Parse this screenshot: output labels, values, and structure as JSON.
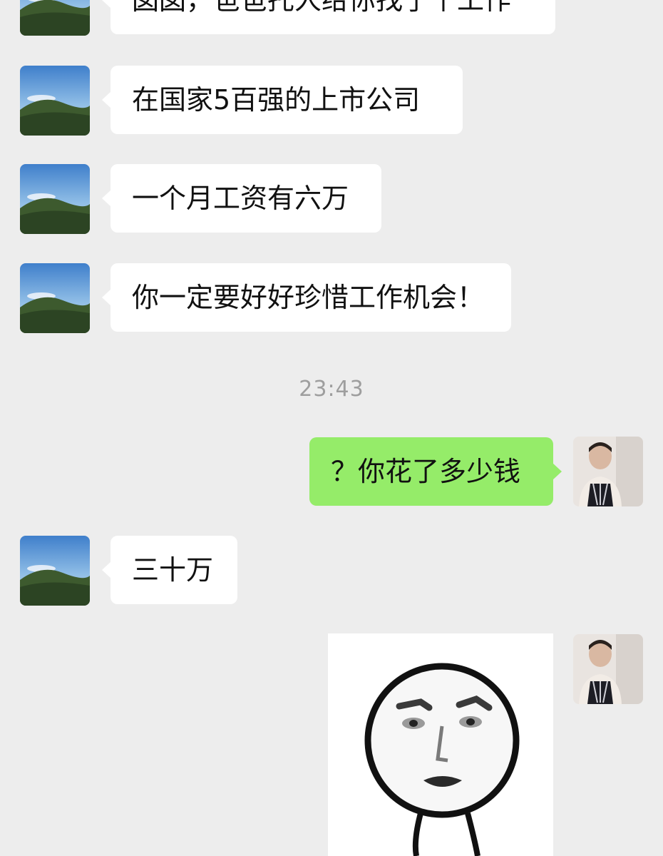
{
  "colors": {
    "background": "#ededed",
    "incoming_bubble": "#ffffff",
    "outgoing_bubble": "#95ec69",
    "timestamp": "#9e9e9e"
  },
  "messages": [
    {
      "side": "incoming",
      "text": "囡囡，爸爸托人给你找了个工作"
    },
    {
      "side": "incoming",
      "text": "在国家5百强的上市公司"
    },
    {
      "side": "incoming",
      "text": "一个月工资有六万"
    },
    {
      "side": "incoming",
      "text": "你一定要好好珍惜工作机会！"
    },
    {
      "side": "outgoing",
      "text": "？你花了多少钱"
    },
    {
      "side": "incoming",
      "text": "三十万"
    },
    {
      "side": "outgoing",
      "type": "sticker",
      "sticker": "shocked-face-meme"
    }
  ],
  "timestamp": "23:43",
  "avatars": {
    "contact": "mountain-landscape-avatar",
    "self": "user-photo-avatar"
  }
}
